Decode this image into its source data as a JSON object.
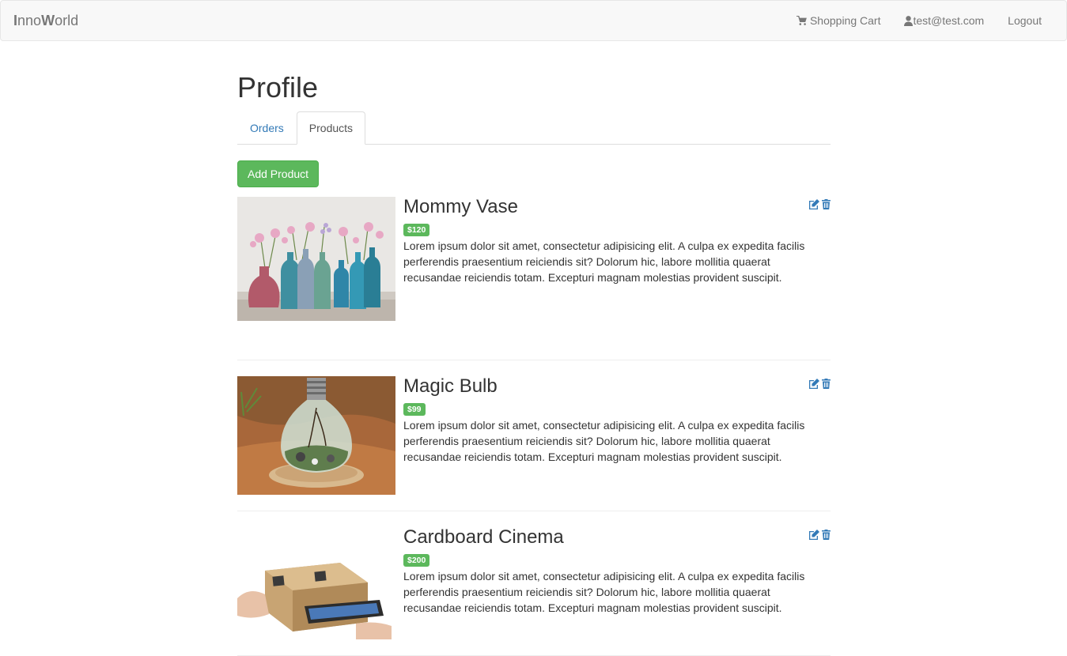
{
  "navbar": {
    "brand_part1": "I",
    "brand_part2": "nno",
    "brand_part3": "W",
    "brand_part4": "orld",
    "cart_label": "Shopping Cart",
    "user_label": "test@test.com",
    "logout_label": "Logout"
  },
  "page": {
    "title": "Profile",
    "tabs": [
      {
        "label": "Orders"
      },
      {
        "label": "Products"
      }
    ],
    "active_tab": "Products",
    "add_button": "Add Product"
  },
  "products": [
    {
      "name": "Mommy Vase",
      "price": "$120",
      "description": "Lorem ipsum dolor sit amet, consectetur adipisicing elit. A culpa ex expedita facilis perferendis praesentium reiciendis sit? Dolorum hic, labore mollitia quaerat recusandae reiciendis totam. Excepturi magnam molestias provident suscipit."
    },
    {
      "name": "Magic Bulb",
      "price": "$99",
      "description": "Lorem ipsum dolor sit amet, consectetur adipisicing elit. A culpa ex expedita facilis perferendis praesentium reiciendis sit? Dolorum hic, labore mollitia quaerat recusandae reiciendis totam. Excepturi magnam molestias provident suscipit."
    },
    {
      "name": "Cardboard Cinema",
      "price": "$200",
      "description": "Lorem ipsum dolor sit amet, consectetur adipisicing elit. A culpa ex expedita facilis perferendis praesentium reiciendis sit? Dolorum hic, labore mollitia quaerat recusandae reiciendis totam. Excepturi magnam molestias provident suscipit."
    }
  ],
  "colors": {
    "accent": "#337ab7",
    "success": "#5cb85c",
    "navbar_bg": "#f8f8f8"
  },
  "icons": {
    "cart": "shopping-cart-icon",
    "user": "user-icon",
    "edit": "edit-icon",
    "delete": "trash-icon"
  }
}
